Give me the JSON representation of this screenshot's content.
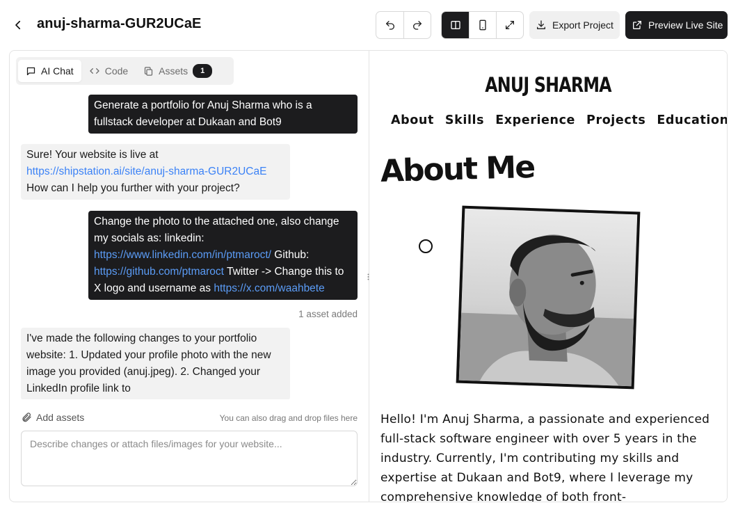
{
  "header": {
    "project_name": "anuj-sharma-GUR2UCaE",
    "export_label": "Export Project",
    "preview_label": "Preview Live Site"
  },
  "tabs": [
    {
      "label": "AI Chat",
      "icon": "chat-icon",
      "active": true
    },
    {
      "label": "Code",
      "icon": "code-icon",
      "active": false
    },
    {
      "label": "Assets",
      "icon": "copy-icon",
      "active": false,
      "badge": "1"
    }
  ],
  "chat": {
    "messages": [
      {
        "role": "user",
        "parts": [
          {
            "text": "Generate a portfolio for Anuj Sharma who is a fullstack developer at Dukaan and Bot9"
          }
        ]
      },
      {
        "role": "assistant",
        "parts": [
          {
            "text": "Sure! Your website is live at "
          },
          {
            "text": "https://shipstation.ai/site/anuj-sharma-GUR2UCaE",
            "link": true
          },
          {
            "text": " How can I help you further with your project?"
          }
        ]
      },
      {
        "role": "user",
        "parts": [
          {
            "text": "Change the photo to the attached one, also change my socials as: linkedin: "
          },
          {
            "text": "https://www.linkedin.com/in/ptmaroct/",
            "link": true
          },
          {
            "text": " Github: "
          },
          {
            "text": "https://github.com/ptmaroct",
            "link": true
          },
          {
            "text": " Twitter -> Change this to X logo and username as "
          },
          {
            "text": "https://x.com/waahbete",
            "link": true
          }
        ]
      },
      {
        "role": "assistant",
        "parts": [
          {
            "text": "I've made the following changes to your portfolio website: 1. Updated your profile photo with the new image you provided (anuj.jpeg). 2. Changed your LinkedIn profile link to"
          }
        ]
      }
    ],
    "asset_note": "1 asset added",
    "add_assets_label": "Add assets",
    "drop_hint": "You can also drag and drop files here",
    "input_placeholder": "Describe changes or attach files/images for your website..."
  },
  "preview": {
    "site_name": "ANUJ SHARMA",
    "nav": [
      "About",
      "Skills",
      "Experience",
      "Projects",
      "Education"
    ],
    "about_heading": "About Me",
    "about_text": "Hello! I'm Anuj Sharma, a passionate and experienced full-stack software engineer with over 5 years in the industry. Currently, I'm contributing my skills and expertise at Dukaan and Bot9, where I leverage my comprehensive knowledge of both front-"
  }
}
